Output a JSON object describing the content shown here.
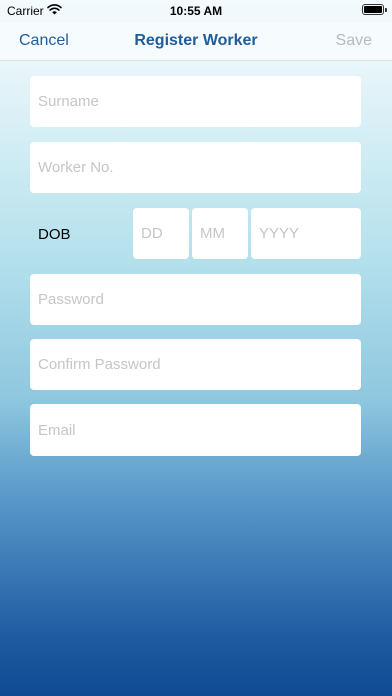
{
  "status_bar": {
    "carrier": "Carrier",
    "time": "10:55 AM"
  },
  "nav": {
    "cancel_label": "Cancel",
    "title": "Register Worker",
    "save_label": "Save"
  },
  "form": {
    "surname_placeholder": "Surname",
    "worker_no_placeholder": "Worker No.",
    "dob_label": "DOB",
    "dob_day_placeholder": "DD",
    "dob_month_placeholder": "MM",
    "dob_year_placeholder": "YYYY",
    "password_placeholder": "Password",
    "confirm_password_placeholder": "Confirm Password",
    "email_placeholder": "Email"
  },
  "colors": {
    "accent": "#1f5d9c",
    "disabled": "#b3bcc3",
    "placeholder": "#c3c6ca"
  }
}
